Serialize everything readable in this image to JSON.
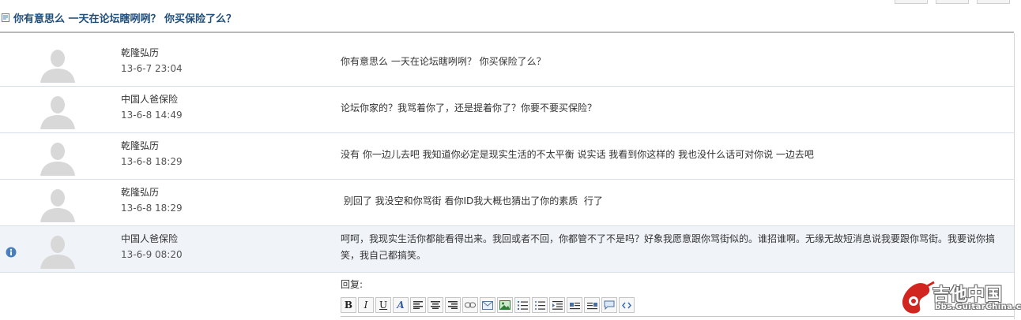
{
  "thread": {
    "title": "你有意思么 一天在论坛瞎咧咧？ 你买保险了么？"
  },
  "messages": [
    {
      "name": "乾隆弘历",
      "time": "13-6-7 23:04",
      "body": "你有意思么 一天在论坛瞎咧咧？ 你买保险了么？"
    },
    {
      "name": "中国人爸保险",
      "time": "13-6-8 14:49",
      "body": "论坛你家的？我骂着你了，还是提着你了？你要不要买保险？"
    },
    {
      "name": "乾隆弘历",
      "time": "13-6-8 18:29",
      "body": "没有 你一边儿去吧 我知道你必定是现实生活的不太平衡 说实话 我看到你这样的 我也没什么话可对你说  一边去吧"
    },
    {
      "name": "乾隆弘历",
      "time": "13-6-8 18:29",
      "body": " 别回了 我没空和你骂街 看你ID我大概也猜出了你的素质  行了"
    },
    {
      "name": "中国人爸保险",
      "time": "13-6-9 08:20",
      "body": "呵呵，我现实生活你都能看得出来。我回或者不回，你都管不了不是吗？好象我愿意跟你骂街似的。谁招谁啊。无缘无故短消息说我要跟你骂街。我要说你搞笑，我自己都搞笑。"
    }
  ],
  "reply": {
    "label": "回复:"
  },
  "toolbar": {
    "bold": "B",
    "italic": "I",
    "underline": "U",
    "font": "A"
  },
  "logo": {
    "main": "吉他中国",
    "sub": "bbs.GuitarChina.com"
  },
  "colors": {
    "title": "#1e4e79",
    "selected_row": "#f0f4f9",
    "divider": "#d7e0ea",
    "logo_red": "#d1261f"
  }
}
